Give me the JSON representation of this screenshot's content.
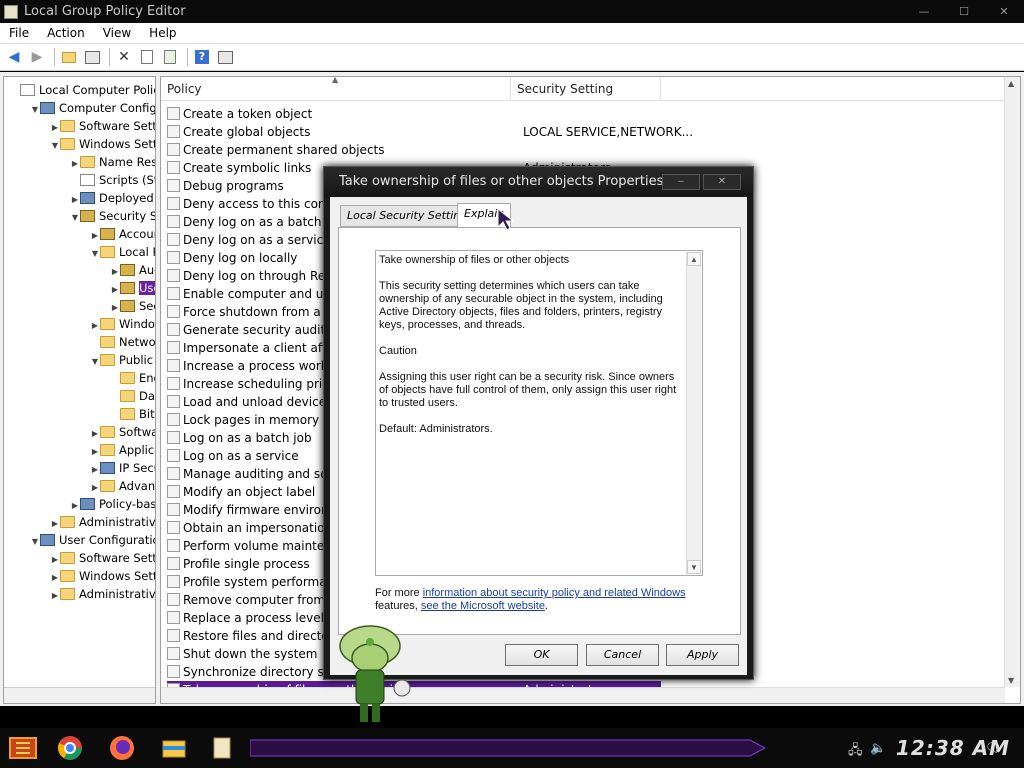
{
  "window": {
    "title": "Local Group Policy Editor"
  },
  "menu": [
    "File",
    "Action",
    "View",
    "Help"
  ],
  "toolbar_icons": [
    "back-arrow-icon",
    "forward-arrow-icon",
    "up-folder-icon",
    "show-hide-tree-icon",
    "delete-icon",
    "properties-icon",
    "export-list-icon",
    "help-icon",
    "show-hide-action-pane-icon"
  ],
  "tree": [
    {
      "label": "Local Computer Policy",
      "icon": "doc",
      "indent": 0,
      "exp": ""
    },
    {
      "label": "Computer Configuration",
      "icon": "pc",
      "indent": 1,
      "exp": "▼"
    },
    {
      "label": "Software Settings",
      "icon": "folder",
      "indent": 2,
      "exp": "▶"
    },
    {
      "label": "Windows Settings",
      "icon": "folder",
      "indent": 2,
      "exp": "▼"
    },
    {
      "label": "Name Resolution Policy",
      "icon": "folder",
      "indent": 3,
      "exp": "▶"
    },
    {
      "label": "Scripts (Startup/Shutdown)",
      "icon": "doc",
      "indent": 3,
      "exp": ""
    },
    {
      "label": "Deployed Printers",
      "icon": "pc",
      "indent": 3,
      "exp": "▶"
    },
    {
      "label": "Security Settings",
      "icon": "shield",
      "indent": 3,
      "exp": "▼"
    },
    {
      "label": "Account Policies",
      "icon": "shield",
      "indent": 4,
      "exp": "▶"
    },
    {
      "label": "Local Policies",
      "icon": "folder",
      "indent": 4,
      "exp": "▼"
    },
    {
      "label": "Audit Policy",
      "icon": "shield",
      "indent": 5,
      "exp": "▶"
    },
    {
      "label": "User Rights Assignment",
      "icon": "shield",
      "indent": 5,
      "exp": "▶",
      "selected": true
    },
    {
      "label": "Security Options",
      "icon": "shield",
      "indent": 5,
      "exp": "▶"
    },
    {
      "label": "Windows Defender Firewall",
      "icon": "folder",
      "indent": 4,
      "exp": "▶"
    },
    {
      "label": "Network List Manager Policies",
      "icon": "folder",
      "indent": 4,
      "exp": ""
    },
    {
      "label": "Public Key Policies",
      "icon": "folder",
      "indent": 4,
      "exp": "▼"
    },
    {
      "label": "Encrypting File System",
      "icon": "folder",
      "indent": 5,
      "exp": ""
    },
    {
      "label": "Data Protection",
      "icon": "folder",
      "indent": 5,
      "exp": ""
    },
    {
      "label": "BitLocker Drive Encryption",
      "icon": "folder",
      "indent": 5,
      "exp": ""
    },
    {
      "label": "Software Restriction Policies",
      "icon": "folder",
      "indent": 4,
      "exp": "▶"
    },
    {
      "label": "Application Control Policies",
      "icon": "folder",
      "indent": 4,
      "exp": "▶"
    },
    {
      "label": "IP Security Policies on Local Computer",
      "icon": "pc",
      "indent": 4,
      "exp": "▶"
    },
    {
      "label": "Advanced Audit Policy Configuration",
      "icon": "folder",
      "indent": 4,
      "exp": "▶"
    },
    {
      "label": "Policy-based QoS",
      "icon": "pc",
      "indent": 3,
      "exp": "▶"
    },
    {
      "label": "Administrative Templates",
      "icon": "folder",
      "indent": 2,
      "exp": "▶"
    },
    {
      "label": "User Configuration",
      "icon": "pc",
      "indent": 1,
      "exp": "▼"
    },
    {
      "label": "Software Settings",
      "icon": "folder",
      "indent": 2,
      "exp": "▶"
    },
    {
      "label": "Windows Settings",
      "icon": "folder",
      "indent": 2,
      "exp": "▶"
    },
    {
      "label": "Administrative Templates",
      "icon": "folder",
      "indent": 2,
      "exp": "▶"
    }
  ],
  "list": {
    "col_policy": "Policy",
    "col_setting": "Security Setting",
    "rows": [
      {
        "name": "Create a token object",
        "value": ""
      },
      {
        "name": "Create global objects",
        "value": "LOCAL SERVICE,NETWORK..."
      },
      {
        "name": "Create permanent shared objects",
        "value": ""
      },
      {
        "name": "Create symbolic links",
        "value": "Administrators"
      },
      {
        "name": "Debug programs",
        "value": ""
      },
      {
        "name": "Deny access to this computer from the network",
        "value": ""
      },
      {
        "name": "Deny log on as a batch job",
        "value": ""
      },
      {
        "name": "Deny log on as a service",
        "value": ""
      },
      {
        "name": "Deny log on locally",
        "value": ""
      },
      {
        "name": "Deny log on through Remote Desktop Services",
        "value": ""
      },
      {
        "name": "Enable computer and user accounts to be trusted for delegation",
        "value": ""
      },
      {
        "name": "Force shutdown from a remote system",
        "value": ""
      },
      {
        "name": "Generate security audits",
        "value": ""
      },
      {
        "name": "Impersonate a client after authentication",
        "value": ""
      },
      {
        "name": "Increase a process working set",
        "value": ""
      },
      {
        "name": "Increase scheduling priority",
        "value": ""
      },
      {
        "name": "Load and unload device drivers",
        "value": ""
      },
      {
        "name": "Lock pages in memory",
        "value": ""
      },
      {
        "name": "Log on as a batch job",
        "value": ""
      },
      {
        "name": "Log on as a service",
        "value": ""
      },
      {
        "name": "Manage auditing and security log",
        "value": ""
      },
      {
        "name": "Modify an object label",
        "value": ""
      },
      {
        "name": "Modify firmware environment values",
        "value": ""
      },
      {
        "name": "Obtain an impersonation token for another user in the same session",
        "value": ""
      },
      {
        "name": "Perform volume maintenance tasks",
        "value": ""
      },
      {
        "name": "Profile single process",
        "value": ""
      },
      {
        "name": "Profile system performance",
        "value": ""
      },
      {
        "name": "Remove computer from docking station",
        "value": ""
      },
      {
        "name": "Replace a process level token",
        "value": ""
      },
      {
        "name": "Restore files and directories",
        "value": ""
      },
      {
        "name": "Shut down the system",
        "value": ""
      },
      {
        "name": "Synchronize directory service data",
        "value": ""
      },
      {
        "name": "Take ownership of files or other objects",
        "value": "Administrators",
        "selected": true
      }
    ]
  },
  "dialog": {
    "title": "Take ownership of files or other objects Properties",
    "tab_local": "Local Security Setting",
    "tab_explain": "Explain",
    "explain_paragraphs": [
      "Take ownership of files or other objects",
      "This security setting determines which users can take ownership of any securable object in the system, including Active Directory objects, files and folders, printers, registry keys, processes, and threads.",
      "Caution",
      "Assigning this user right can be a security risk. Since owners of objects have full control of them, only assign this user right to trusted users.",
      "Default: Administrators."
    ],
    "footer_pre": "For more ",
    "footer_link1": "information about security policy and related Windows",
    "footer_mid": " features, ",
    "footer_link2": "see the Microsoft website",
    "footer_post": ".",
    "ok": "OK",
    "cancel": "Cancel",
    "apply": "Apply"
  },
  "taskbar": {
    "clock": "12:38 AM"
  }
}
